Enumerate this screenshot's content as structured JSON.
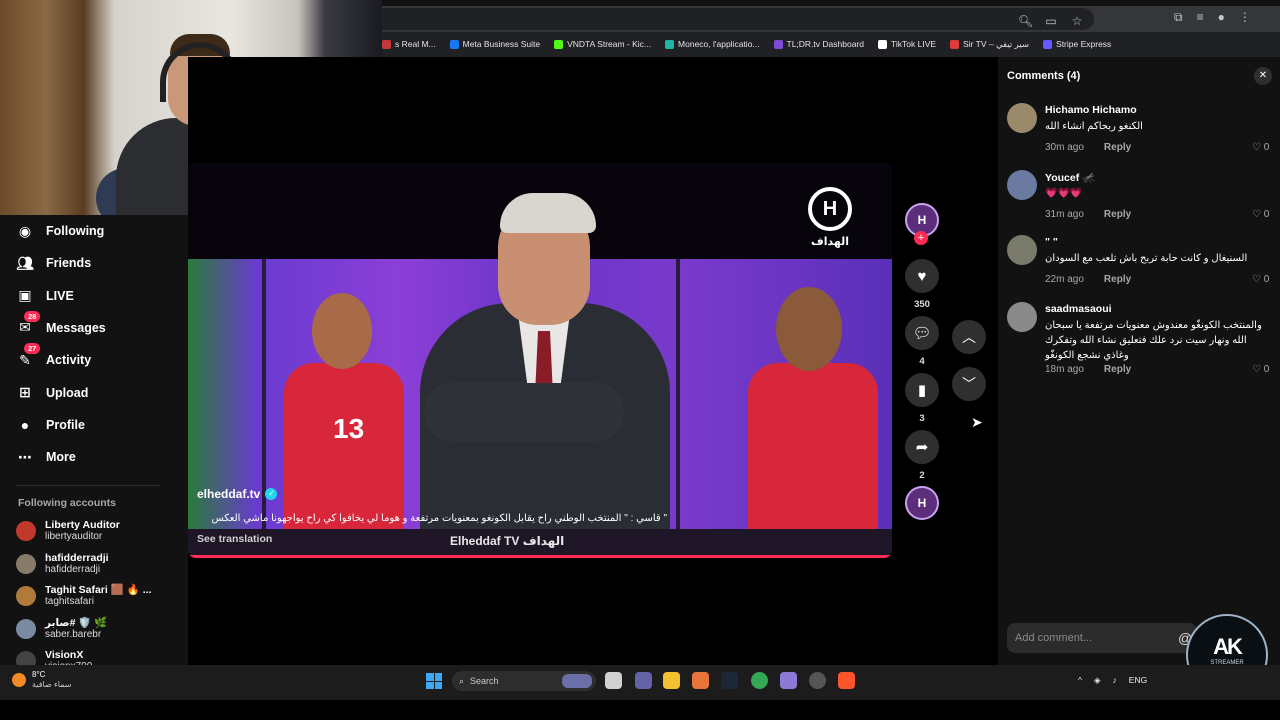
{
  "browser": {
    "bookmarks": [
      {
        "label": "s Real M...",
        "color": "#c43838"
      },
      {
        "label": "Meta Business Suite",
        "color": "#1877f2"
      },
      {
        "label": "VNDTA Stream - Kic...",
        "color": "#53fc18"
      },
      {
        "label": "Moneco, l'applicatio...",
        "color": "#1fb6a6"
      },
      {
        "label": "TL;DR.tv Dashboard",
        "color": "#7d4bd6"
      },
      {
        "label": "TikTok LIVE",
        "color": "#ffffff"
      },
      {
        "label": "Sir TV – سير تيفي",
        "color": "#e23a3a"
      },
      {
        "label": "Stripe Express",
        "color": "#635bff"
      }
    ]
  },
  "sidebar": {
    "nav": [
      {
        "label": "Following",
        "icon": "following-avatar-icon"
      },
      {
        "label": "Friends",
        "icon": "friends-icon"
      },
      {
        "label": "LIVE",
        "icon": "live-icon"
      },
      {
        "label": "Messages",
        "icon": "messages-icon",
        "badge": "28"
      },
      {
        "label": "Activity",
        "icon": "activity-icon",
        "badge": "27"
      },
      {
        "label": "Upload",
        "icon": "upload-icon"
      },
      {
        "label": "Profile",
        "icon": "profile-icon"
      },
      {
        "label": "More",
        "icon": "more-icon"
      }
    ],
    "following_title": "Following accounts",
    "accounts": [
      {
        "name": "Liberty Auditor",
        "handle": "libertyauditor",
        "color": "#c0392b"
      },
      {
        "name": "hafidderradji",
        "handle": "hafidderradji",
        "color": "#8a7a6a",
        "verified": true
      },
      {
        "name": "Taghit Safari 🟫 🔥 ...",
        "handle": "taghitsafari",
        "color": "#b07a3a"
      },
      {
        "name": "صابر# 🛡️ 🌿",
        "handle": "saber.barebr",
        "color": "#7a8aa0"
      },
      {
        "name": "VisionX",
        "handle": "visionx700",
        "color": "#444"
      }
    ]
  },
  "video": {
    "author": "elheddaf.tv",
    "caption": "\" قاسي : \" المنتخب الوطني راح يقابل الكونغو بمعنويات مرتفعة و هوما لي يخافوا كي راح يواجهونا ماشي العكس",
    "translate_label": "See translation",
    "watermark": "Elheddaf TV الهداف",
    "channel_logo": "الهداف",
    "jersey_number": "13"
  },
  "actions": {
    "likes": "350",
    "comments": "4",
    "saves": "3",
    "shares": "2"
  },
  "comments_panel": {
    "title": "Comments (4)",
    "reply_label": "Reply",
    "input_placeholder": "Add comment...",
    "items": [
      {
        "name": "Hichamo Hichamo",
        "text": "الكنغو ربحاكم انشاء الله",
        "time": "30m ago",
        "likes": "0",
        "color": "#9a8a6a"
      },
      {
        "name": "Youcef 🦟",
        "text": "💗💗💗",
        "time": "31m ago",
        "likes": "0",
        "color": "#6a7aa0"
      },
      {
        "name": "\" \"",
        "text": "السنيغال و كانت حابة تربح باش تلعب مع السودان",
        "time": "22m ago",
        "likes": "0",
        "color": "#7a7a6a"
      },
      {
        "name": "saadmasaoui",
        "text": "والمنتخب الكونغّو معندوش معنويات مرتفعة يا سبحان الله ونهار سيت نرد علك فتعليق نشاء الله وتفكرك وغاذي نشجع الكونغّو",
        "time": "18m ago",
        "likes": "0",
        "color": "#8a8a8a"
      }
    ]
  },
  "taskbar": {
    "temp": "8°C",
    "condition": "سماء صافية",
    "search_label": "Search",
    "lang": "ENG"
  },
  "overlay_logo": {
    "mark": "AK",
    "sub": "STREAMER"
  }
}
